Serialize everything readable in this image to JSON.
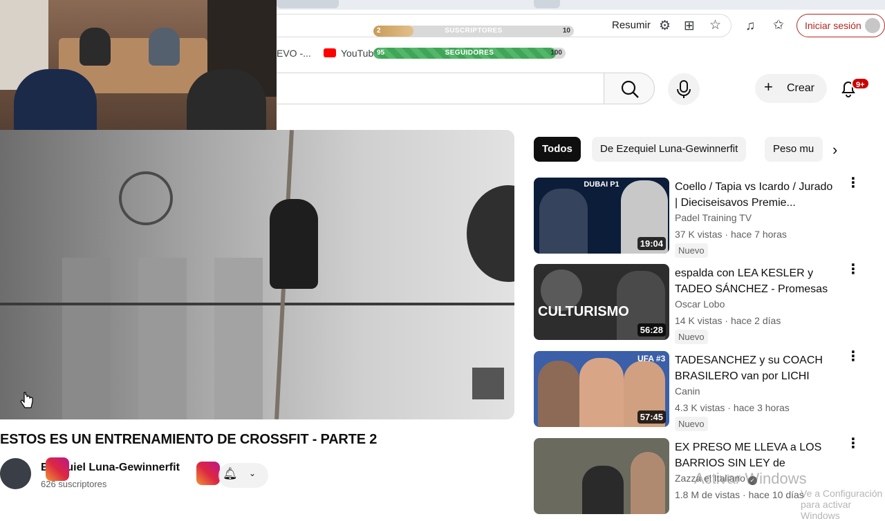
{
  "browser": {
    "summarize_label": "Resumir",
    "signin_label": "Iniciar sesión",
    "bookmarks": [
      {
        "label": "EVO -..."
      },
      {
        "label": "YouTub"
      }
    ]
  },
  "overlay": {
    "subscribers_bar": {
      "label": "SUSCRIPTORES",
      "current": "2",
      "goal": "10",
      "progress": 0.2
    },
    "followers_bar": {
      "label": "SEGUIDORES",
      "current": "95",
      "goal": "100",
      "progress": 0.95
    }
  },
  "youtube": {
    "create_label": "Crear",
    "notifications_badge": "9+"
  },
  "video": {
    "title": "ESTOS ES UN ENTRENAMIENTO DE CROSSFIT - PARTE 2",
    "channel_name": "Ezequiel Luna-Gewinnerfit",
    "subscribers": "626 suscriptores"
  },
  "chips": [
    {
      "label": "Todos",
      "active": true
    },
    {
      "label": "De Ezequiel Luna-Gewinnerfit",
      "active": false
    },
    {
      "label": "Peso mu",
      "active": false
    }
  ],
  "recommendations": [
    {
      "title": "Coello / Tapia vs Icardo / Jurado | Dieciseisavos Premie...",
      "channel": "Padel Training TV",
      "views": "37 K vistas",
      "age": "hace 7 horas",
      "badge": "Nuevo",
      "duration": "19:04",
      "thumb_text": "DUBAI P1",
      "thumb_color": "#0c1d3a"
    },
    {
      "title": "espalda con LEA KESLER y TADEO SÁNCHEZ - Promesas ...",
      "channel": "Oscar Lobo",
      "views": "14 K vistas",
      "age": "hace 2 días",
      "badge": "Nuevo",
      "duration": "56:28",
      "thumb_text": "CULTURISMO",
      "thumb_color": "#2d2d2d"
    },
    {
      "title": "TADESANCHEZ y su COACH BRASILERO van por LICHI Roa...",
      "channel": "Canin",
      "views": "4.3 K vistas",
      "age": "hace 3 horas",
      "badge": "Nuevo",
      "duration": "57:45",
      "thumb_text": "UFA #3",
      "thumb_color": "#3b5fa8"
    },
    {
      "title": "EX PRESO ME LLEVA a LOS BARRIOS SIN LEY de ROSARI...",
      "channel": "Zazza el Italiano",
      "views": "1.8 M de vistas",
      "age": "hace 10 días",
      "badge": "",
      "duration": "",
      "thumb_text": "",
      "thumb_color": "#6a6a5e"
    }
  ],
  "system": {
    "watermark": "Activar Windows",
    "watermark_sub": "Ve a Configuración para activar Windows"
  }
}
